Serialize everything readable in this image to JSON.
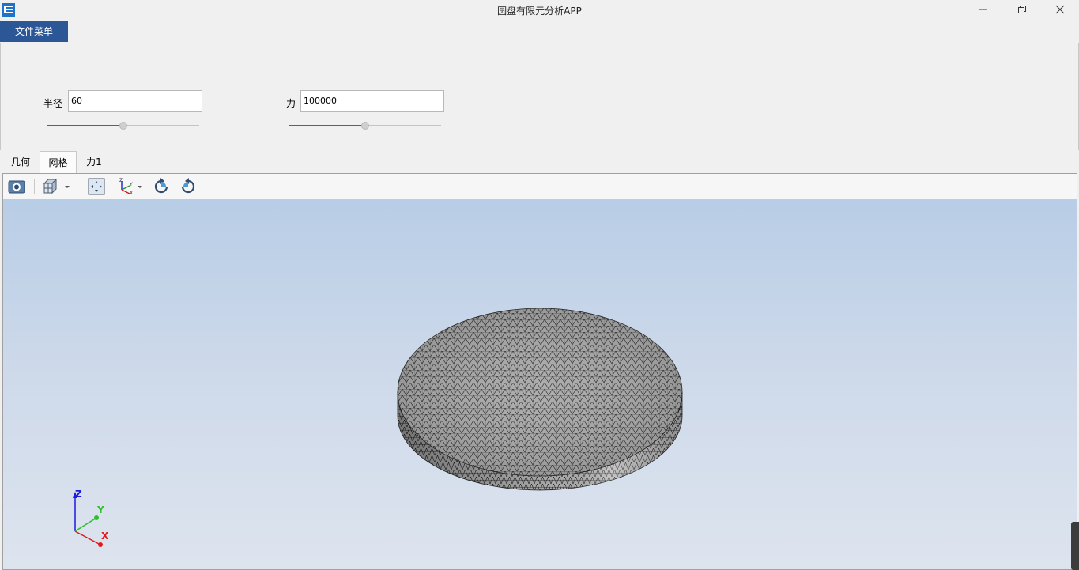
{
  "window": {
    "title": "圆盘有限元分析APP",
    "app_icon": "app-icon"
  },
  "menu": {
    "file_menu": "文件菜单"
  },
  "params": {
    "radius": {
      "label": "半径",
      "value": "60",
      "slider_fraction": 0.5
    },
    "force": {
      "label": "力",
      "value": "100000",
      "slider_fraction": 0.5
    }
  },
  "tabs": [
    {
      "label": "几何",
      "active": false
    },
    {
      "label": "网格",
      "active": true
    },
    {
      "label": "力1",
      "active": false
    }
  ],
  "toolbar": {
    "icons": [
      "camera-icon",
      "view-cube-icon",
      "zoom-extents-icon",
      "axes-orientation-icon",
      "rotate-left-icon",
      "rotate-right-icon"
    ]
  },
  "axes": {
    "x": "X",
    "y": "Y",
    "z": "Z"
  },
  "colors": {
    "menu_accent": "#2b5797",
    "slider_fill": "#1f6fc0",
    "axis_x": "#e01b1b",
    "axis_y": "#2dbf2d",
    "axis_z": "#1b1be0"
  }
}
